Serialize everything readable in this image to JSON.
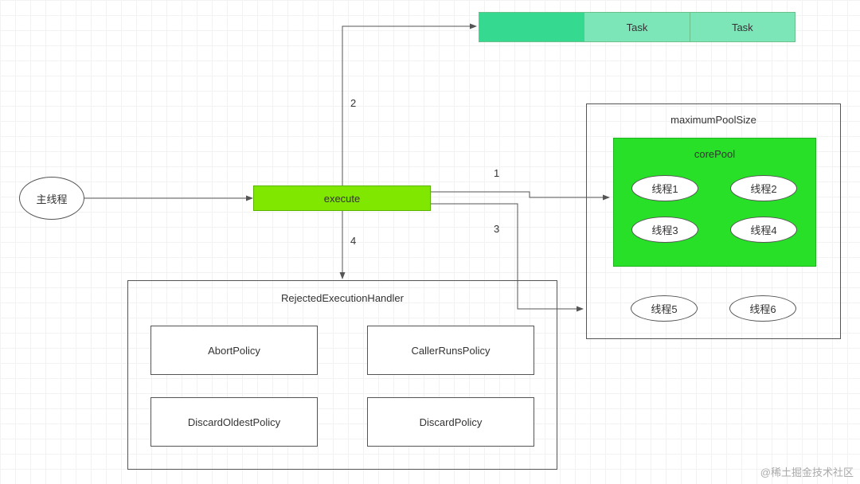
{
  "mainThread": {
    "label": "主线程"
  },
  "execute": {
    "label": "execute"
  },
  "taskQueue": {
    "cells": [
      "",
      "Task",
      "Task"
    ]
  },
  "maxPool": {
    "title": "maximumPoolSize",
    "corePool": {
      "title": "corePool",
      "threads": [
        "线程1",
        "线程2",
        "线程3",
        "线程4"
      ]
    },
    "extraThreads": [
      "线程5",
      "线程6"
    ]
  },
  "rejected": {
    "title": "RejectedExecutionHandler",
    "policies": [
      "AbortPolicy",
      "CallerRunsPolicy",
      "DiscardOldestPolicy",
      "DiscardPolicy"
    ]
  },
  "edges": {
    "label1": "1",
    "label2": "2",
    "label3": "3",
    "label4": "4"
  },
  "watermark": "@稀土掘金技术社区"
}
